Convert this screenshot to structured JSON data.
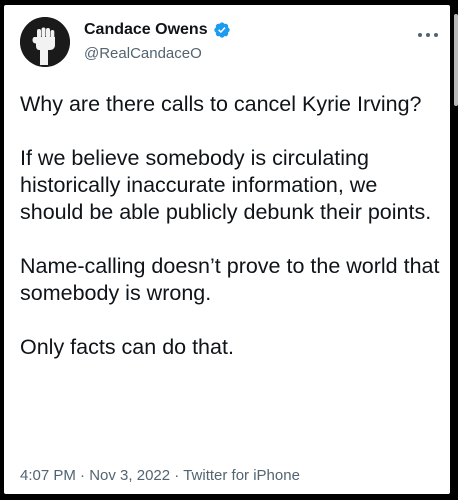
{
  "tweet": {
    "display_name": "Candace Owens",
    "handle": "@RealCandaceO",
    "paragraphs": [
      "Why are there calls to cancel Kyrie Irving?",
      "If we believe somebody is circulating historically inaccurate information, we should be able publicly debunk their points.",
      "Name-calling doesn’t prove to the world that somebody is wrong.",
      "Only facts can do that."
    ],
    "time": "4:07 PM",
    "separator": "·",
    "date": "Nov 3, 2022",
    "source": "Twitter for iPhone"
  },
  "icons": {
    "avatar": "raised-fist-avatar",
    "verified": "verified-badge-icon",
    "more": "more-options-icon"
  },
  "colors": {
    "text": "#0f1419",
    "secondary": "#536471",
    "verified": "#1d9bf0",
    "background": "#ffffff"
  }
}
